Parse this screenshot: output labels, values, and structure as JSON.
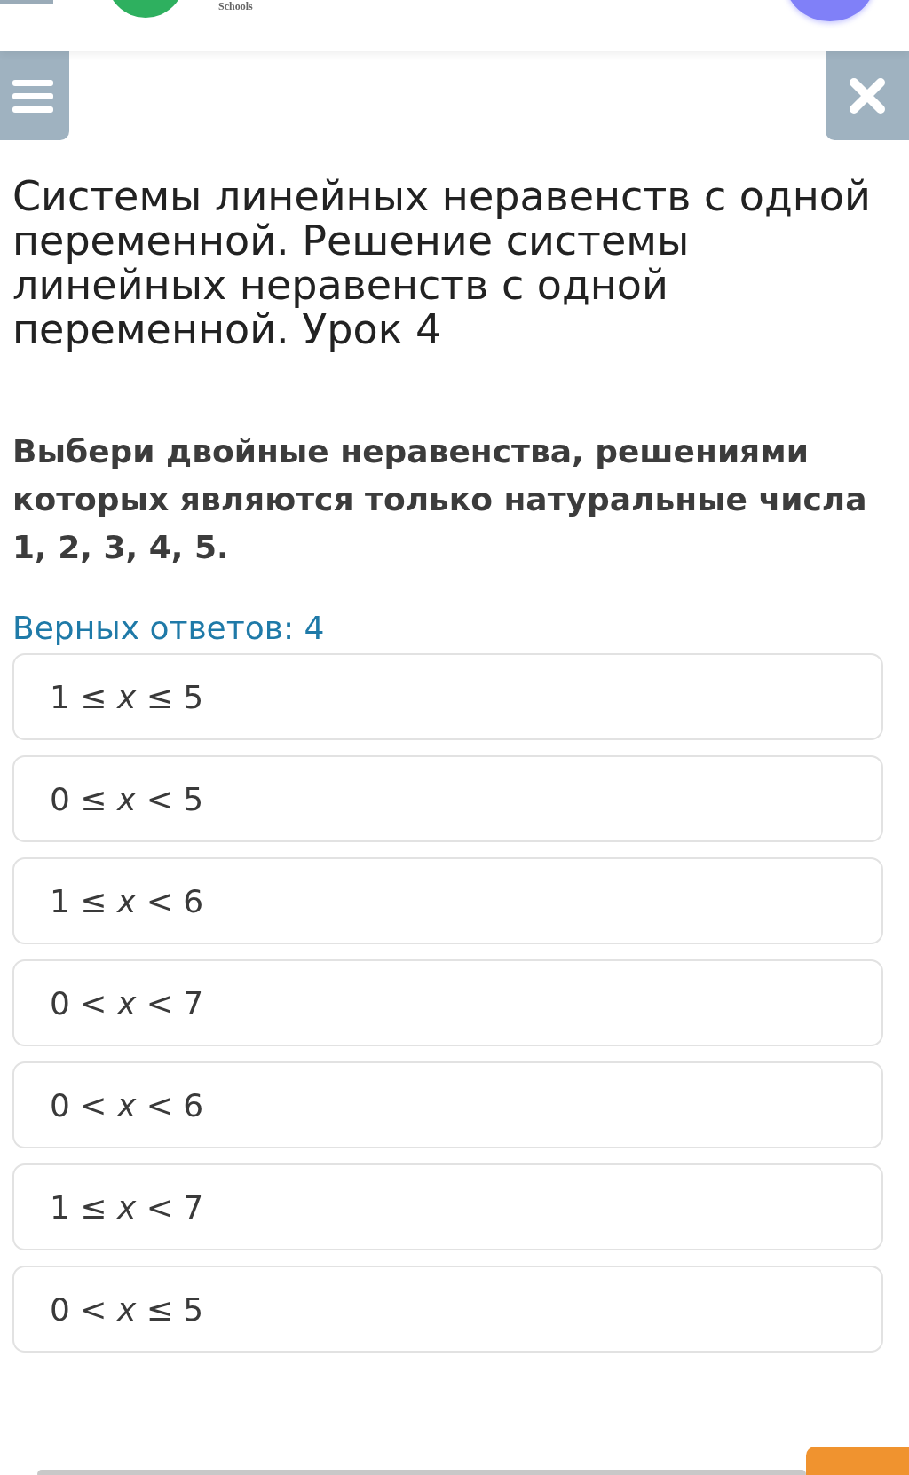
{
  "header": {
    "logo_text": "Schools"
  },
  "title": "Системы линейных неравенств с одной переменной. Решение системы линейных неравенств с одной переменной. Урок 4",
  "question": "Выбери двойные неравенства, решениями которых являются только натуральные числа 1, 2, 3, 4, 5.",
  "answers_count": "Верных ответов: 4",
  "options": [
    {
      "text": "1 ≤ *x* ≤ 5"
    },
    {
      "text": "0 ≤ *x* < 5"
    },
    {
      "text": "1 ≤ *x* < 6"
    },
    {
      "text": "0 < *x* < 7"
    },
    {
      "text": "0 < *x* < 6"
    },
    {
      "text": "1 ≤ *x* < 7"
    },
    {
      "text": "0 < *x* ≤ 5"
    }
  ]
}
